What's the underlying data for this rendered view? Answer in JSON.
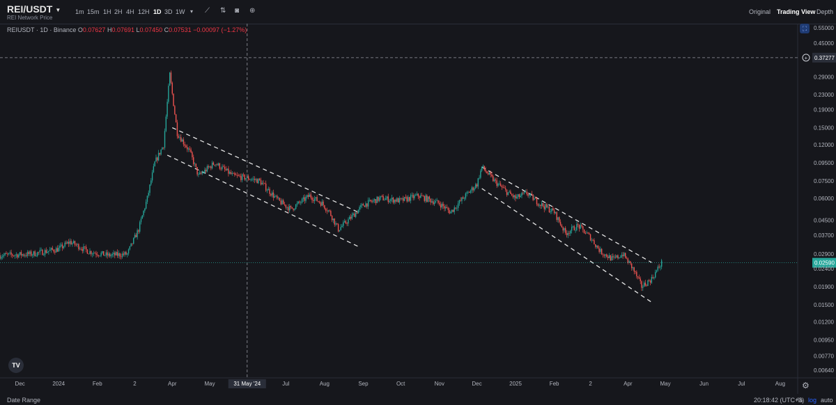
{
  "header": {
    "symbol": "REI/USDT",
    "subtitle": "REI Network Price",
    "timeframes": [
      "1m",
      "15m",
      "1H",
      "2H",
      "4H",
      "12H",
      "1D",
      "3D",
      "1W"
    ],
    "active_timeframe": "1D",
    "views": [
      "Original",
      "Trading View",
      "Depth"
    ],
    "active_view": "Trading View"
  },
  "legend": {
    "pair": "REIUSDT · 1D · Binance",
    "o_label": "O",
    "o": "0.07627",
    "h_label": "H",
    "h": "0.07691",
    "l_label": "L",
    "l": "0.07450",
    "c_label": "C",
    "c": "0.07531",
    "change": "−0.00097 (−1.27%)"
  },
  "crosshair": {
    "price_label": "0.37277",
    "date_label": "31 May '24"
  },
  "current_price_label": "0.02590",
  "bottom": {
    "date_range": "Date Range",
    "time": "20:18:42 (UTC+3)",
    "percent": "%",
    "log": "log",
    "auto": "auto"
  },
  "colors": {
    "up": "#26a69a",
    "down": "#ef5350",
    "background": "#16171c",
    "accent": "#2962ff"
  },
  "icons": [
    "chevron-down-icon",
    "indicator-icon",
    "compare-icon",
    "camera-icon",
    "add-icon",
    "tradingview-logo-icon",
    "settings-gear-icon",
    "scale-icon"
  ],
  "chart_data": {
    "type": "candlestick",
    "scale": "log",
    "y_tick_labels": [
      "0.55000",
      "0.45000",
      "0.37277",
      "0.29000",
      "0.23000",
      "0.19000",
      "0.15000",
      "0.12000",
      "0.09500",
      "0.07500",
      "0.06000",
      "0.04500",
      "0.03700",
      "0.02900",
      "0.02400",
      "0.01900",
      "0.01500",
      "0.01200",
      "0.00950",
      "0.00770",
      "0.00640"
    ],
    "y_ticks": [
      0.55,
      0.45,
      0.29,
      0.23,
      0.19,
      0.15,
      0.12,
      0.095,
      0.075,
      0.06,
      0.045,
      0.037,
      0.029,
      0.024,
      0.019,
      0.015,
      0.012,
      0.0095,
      0.0077,
      0.0064
    ],
    "ylim": [
      0.0058,
      0.58
    ],
    "x_tick_labels": [
      "Dec",
      "2024",
      "Feb",
      "2",
      "Apr",
      "May",
      "31 May '24",
      "Jul",
      "Aug",
      "Sep",
      "Oct",
      "Nov",
      "Dec",
      "2025",
      "Feb",
      "2",
      "Apr",
      "May",
      "Jun",
      "Jul",
      "Aug"
    ],
    "x_ticks": [
      "2023-12-01",
      "2024-01-01",
      "2024-02-01",
      "2024-03-02",
      "2024-04-01",
      "2024-05-01",
      "2024-05-31",
      "2024-07-01",
      "2024-08-01",
      "2024-09-01",
      "2024-10-01",
      "2024-11-01",
      "2024-12-01",
      "2025-01-01",
      "2025-02-01",
      "2025-03-02",
      "2025-04-01",
      "2025-05-01",
      "2025-06-01",
      "2025-07-01",
      "2025-08-01"
    ],
    "xlim": [
      "2023-11-15",
      "2025-08-15"
    ],
    "series_points": [
      [
        "2023-11-15",
        0.0285
      ],
      [
        "2023-12-10",
        0.029
      ],
      [
        "2024-01-01",
        0.031
      ],
      [
        "2024-01-10",
        0.034
      ],
      [
        "2024-01-25",
        0.03
      ],
      [
        "2024-02-10",
        0.0285
      ],
      [
        "2024-02-25",
        0.029
      ],
      [
        "2024-03-05",
        0.04
      ],
      [
        "2024-03-12",
        0.06
      ],
      [
        "2024-03-18",
        0.095
      ],
      [
        "2024-03-25",
        0.12
      ],
      [
        "2024-03-30",
        0.3
      ],
      [
        "2024-04-05",
        0.14
      ],
      [
        "2024-04-15",
        0.11
      ],
      [
        "2024-04-22",
        0.08
      ],
      [
        "2024-05-05",
        0.095
      ],
      [
        "2024-05-20",
        0.08
      ],
      [
        "2024-05-31",
        0.078
      ],
      [
        "2024-06-10",
        0.075
      ],
      [
        "2024-06-25",
        0.058
      ],
      [
        "2024-07-05",
        0.052
      ],
      [
        "2024-07-20",
        0.062
      ],
      [
        "2024-07-30",
        0.056
      ],
      [
        "2024-08-05",
        0.05
      ],
      [
        "2024-08-12",
        0.04
      ],
      [
        "2024-08-20",
        0.045
      ],
      [
        "2024-09-01",
        0.055
      ],
      [
        "2024-09-15",
        0.06
      ],
      [
        "2024-10-01",
        0.058
      ],
      [
        "2024-10-15",
        0.062
      ],
      [
        "2024-11-01",
        0.056
      ],
      [
        "2024-11-10",
        0.05
      ],
      [
        "2024-11-20",
        0.06
      ],
      [
        "2024-12-01",
        0.072
      ],
      [
        "2024-12-05",
        0.09
      ],
      [
        "2024-12-15",
        0.075
      ],
      [
        "2024-12-25",
        0.065
      ],
      [
        "2025-01-01",
        0.06
      ],
      [
        "2025-01-10",
        0.064
      ],
      [
        "2025-01-20",
        0.056
      ],
      [
        "2025-02-01",
        0.05
      ],
      [
        "2025-02-10",
        0.038
      ],
      [
        "2025-02-20",
        0.042
      ],
      [
        "2025-03-02",
        0.036
      ],
      [
        "2025-03-10",
        0.03
      ],
      [
        "2025-03-20",
        0.027
      ],
      [
        "2025-03-28",
        0.029
      ],
      [
        "2025-04-05",
        0.024
      ],
      [
        "2025-04-12",
        0.019
      ],
      [
        "2025-04-20",
        0.021
      ],
      [
        "2025-04-28",
        0.0259
      ]
    ],
    "channel_lines": [
      {
        "from": [
          "2024-04-01",
          0.15
        ],
        "to": [
          "2024-08-28",
          0.05
        ]
      },
      {
        "from": [
          "2024-03-28",
          0.105
        ],
        "to": [
          "2024-08-28",
          0.032
        ]
      },
      {
        "from": [
          "2024-12-05",
          0.09
        ],
        "to": [
          "2025-04-20",
          0.026
        ]
      },
      {
        "from": [
          "2024-12-05",
          0.068
        ],
        "to": [
          "2025-04-20",
          0.0155
        ]
      }
    ],
    "crosshair": {
      "x": "2024-05-31",
      "y": 0.37277
    },
    "current_price": 0.0259
  }
}
